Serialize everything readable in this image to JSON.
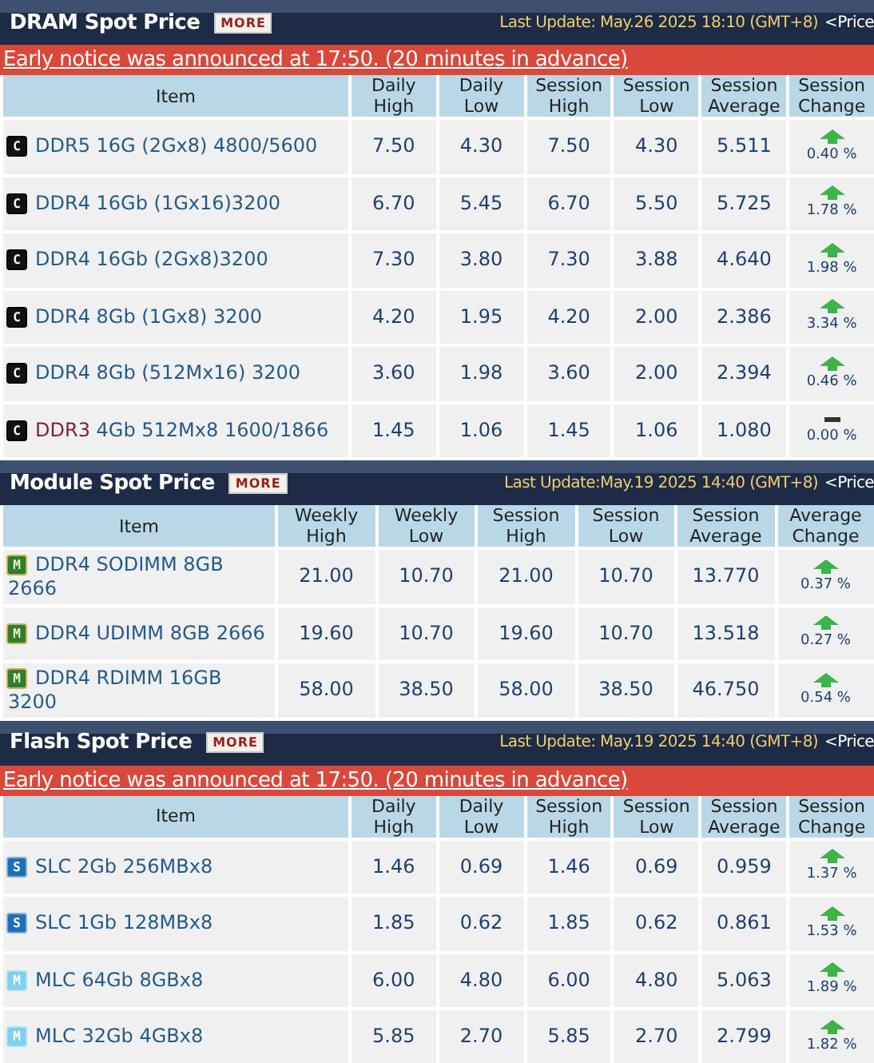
{
  "sections": [
    {
      "title": "DRAM Spot Price",
      "more": "MORE",
      "update": "Last Update: May.26 2025 18:10 (GMT+8)",
      "price_link": "<Price",
      "notice": "Early notice was announced at 17:50. (20 minutes in advance)",
      "columns": [
        "Item",
        "Daily High",
        "Daily Low",
        "Session High",
        "Session Low",
        "Session Average",
        "Session Change"
      ],
      "rows": [
        {
          "icon": {
            "kind": "dram",
            "letter": "C"
          },
          "name": "DDR5 16G (2Gx8) 4800/5600",
          "values": [
            "7.50",
            "4.30",
            "7.50",
            "4.30",
            "5.511"
          ],
          "trend": {
            "kind": "up"
          },
          "change": "0.40 %"
        },
        {
          "icon": {
            "kind": "dram",
            "letter": "C"
          },
          "name": "DDR4 16Gb (1Gx16)3200",
          "values": [
            "6.70",
            "5.45",
            "6.70",
            "5.50",
            "5.725"
          ],
          "trend": {
            "kind": "up"
          },
          "change": "1.78 %"
        },
        {
          "icon": {
            "kind": "dram",
            "letter": "C"
          },
          "name": "DDR4 16Gb (2Gx8)3200",
          "values": [
            "7.30",
            "3.80",
            "7.30",
            "3.88",
            "4.640"
          ],
          "trend": {
            "kind": "up"
          },
          "change": "1.98 %"
        },
        {
          "icon": {
            "kind": "dram",
            "letter": "C"
          },
          "name": "DDR4 8Gb (1Gx8) 3200",
          "values": [
            "4.20",
            "1.95",
            "4.20",
            "2.00",
            "2.386"
          ],
          "trend": {
            "kind": "up"
          },
          "change": "3.34 %"
        },
        {
          "icon": {
            "kind": "dram",
            "letter": "C"
          },
          "name": "DDR4 8Gb (512Mx16) 3200",
          "values": [
            "3.60",
            "1.98",
            "3.60",
            "2.00",
            "2.394"
          ],
          "trend": {
            "kind": "up"
          },
          "change": "0.46 %"
        },
        {
          "icon": {
            "kind": "dram",
            "letter": "C"
          },
          "tag": {
            "text": "DDR3",
            "color": "#7a1f3d"
          },
          "name": "4Gb 512Mx8 1600/1866",
          "values": [
            "1.45",
            "1.06",
            "1.45",
            "1.06",
            "1.080"
          ],
          "trend": {
            "kind": "flat"
          },
          "change": "0.00 %"
        }
      ]
    },
    {
      "title": "Module Spot Price",
      "more": "MORE",
      "update": "Last Update:May.19 2025 14:40 (GMT+8)",
      "price_link": "<Price",
      "columns": [
        "Item",
        "Weekly High",
        "Weekly Low",
        "Session High",
        "Session Low",
        "Session Average",
        "Average Change"
      ],
      "rows": [
        {
          "icon": {
            "kind": "module",
            "letter": "M"
          },
          "name": "DDR4 SODIMM 8GB 2666",
          "values": [
            "21.00",
            "10.70",
            "21.00",
            "10.70",
            "13.770"
          ],
          "trend": {
            "kind": "up"
          },
          "change": "0.37 %"
        },
        {
          "icon": {
            "kind": "module",
            "letter": "M"
          },
          "name": "DDR4 UDIMM 8GB 2666",
          "values": [
            "19.60",
            "10.70",
            "19.60",
            "10.70",
            "13.518"
          ],
          "trend": {
            "kind": "up"
          },
          "change": "0.27 %"
        },
        {
          "icon": {
            "kind": "module",
            "letter": "M"
          },
          "name": "DDR4 RDIMM 16GB 3200",
          "values": [
            "58.00",
            "38.50",
            "58.00",
            "38.50",
            "46.750"
          ],
          "trend": {
            "kind": "up"
          },
          "change": "0.54 %"
        }
      ]
    },
    {
      "title": "Flash Spot Price",
      "more": "MORE",
      "update": "Last Update: May.19 2025 14:40 (GMT+8)",
      "price_link": "<Price",
      "notice": "Early notice was announced at 17:50. (20 minutes in advance)",
      "columns": [
        "Item",
        "Daily High",
        "Daily Low",
        "Session High",
        "Session Low",
        "Session Average",
        "Session Change"
      ],
      "rows": [
        {
          "icon": {
            "kind": "slc",
            "letter": "S"
          },
          "name": "SLC 2Gb 256MBx8",
          "values": [
            "1.46",
            "0.69",
            "1.46",
            "0.69",
            "0.959"
          ],
          "trend": {
            "kind": "up"
          },
          "change": "1.37 %"
        },
        {
          "icon": {
            "kind": "slc",
            "letter": "S"
          },
          "name": "SLC 1Gb 128MBx8",
          "values": [
            "1.85",
            "0.62",
            "1.85",
            "0.62",
            "0.861"
          ],
          "trend": {
            "kind": "up"
          },
          "change": "1.53 %"
        },
        {
          "icon": {
            "kind": "mlc",
            "letter": "M"
          },
          "name": "MLC 64Gb 8GBx8",
          "values": [
            "6.00",
            "4.80",
            "6.00",
            "4.80",
            "5.063"
          ],
          "trend": {
            "kind": "up"
          },
          "change": "1.89 %"
        },
        {
          "icon": {
            "kind": "mlc",
            "letter": "M"
          },
          "name": "MLC 32Gb 4GBx8",
          "values": [
            "5.85",
            "2.70",
            "5.85",
            "2.70",
            "2.799"
          ],
          "trend": {
            "kind": "up"
          },
          "change": "1.82 %"
        }
      ]
    }
  ]
}
